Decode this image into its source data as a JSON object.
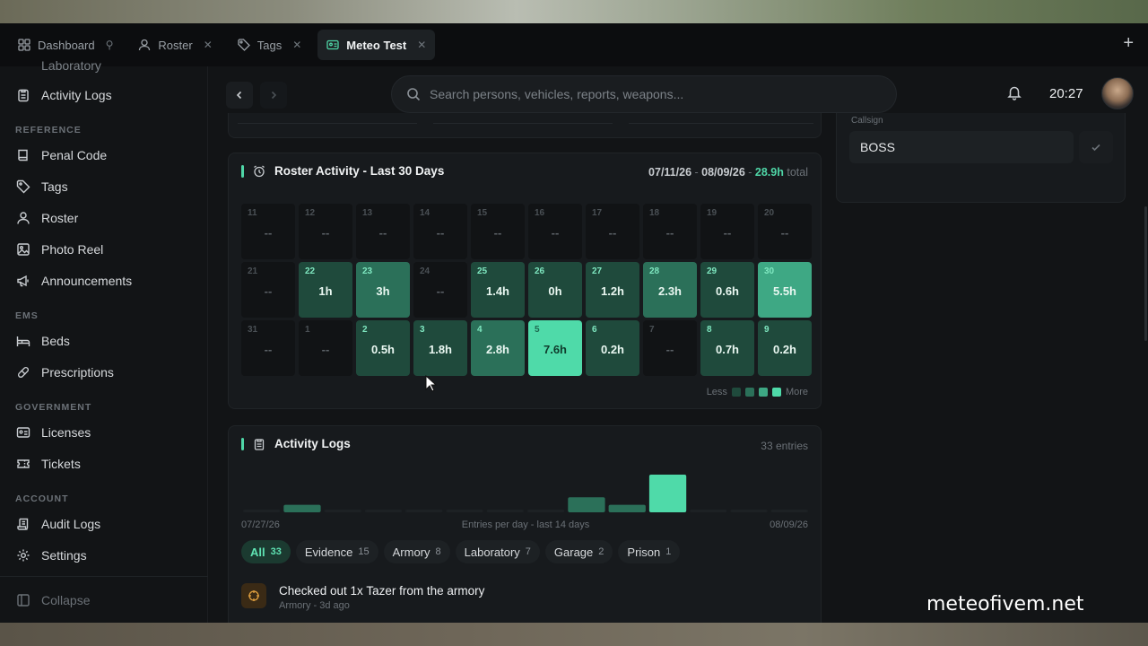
{
  "tabs": [
    {
      "label": "Dashboard",
      "icon": "grid-icon",
      "pinned": true
    },
    {
      "label": "Roster",
      "icon": "user-icon"
    },
    {
      "label": "Tags",
      "icon": "tag-icon"
    },
    {
      "label": "Meteo Test",
      "icon": "id-card-icon",
      "active": true
    }
  ],
  "sidebar": {
    "partial_top": "Laboratory",
    "activity_logs": "Activity Logs",
    "sections": {
      "reference": "REFERENCE",
      "ems": "EMS",
      "government": "GOVERNMENT",
      "account": "ACCOUNT"
    },
    "reference_items": [
      "Penal Code",
      "Tags",
      "Roster",
      "Photo Reel",
      "Announcements"
    ],
    "ems_items": [
      "Beds",
      "Prescriptions"
    ],
    "government_items": [
      "Licenses",
      "Tickets"
    ],
    "account_items": [
      "Audit Logs",
      "Settings"
    ],
    "collapse": "Collapse"
  },
  "topbar": {
    "search_placeholder": "Search persons, vehicles, reports, weapons...",
    "time": "20:27"
  },
  "callsign": {
    "label": "Callsign",
    "value": "BOSS"
  },
  "roster_activity": {
    "title": "Roster Activity - Last 30 Days",
    "range_start": "07/11/26",
    "range_sep": " - ",
    "range_end": "08/09/26",
    "range_dash": " - ",
    "total": "28.9h",
    "total_suffix": "total",
    "legend_less": "Less",
    "legend_more": "More",
    "legend_colors": [
      "#1f4a3c",
      "#2b7059",
      "#3ea884",
      "#4fdaa9"
    ],
    "days": [
      {
        "d": "11",
        "v": "--",
        "level": 0
      },
      {
        "d": "12",
        "v": "--",
        "level": 0
      },
      {
        "d": "13",
        "v": "--",
        "level": 0
      },
      {
        "d": "14",
        "v": "--",
        "level": 0
      },
      {
        "d": "15",
        "v": "--",
        "level": 0
      },
      {
        "d": "16",
        "v": "--",
        "level": 0
      },
      {
        "d": "17",
        "v": "--",
        "level": 0
      },
      {
        "d": "18",
        "v": "--",
        "level": 0
      },
      {
        "d": "19",
        "v": "--",
        "level": 0
      },
      {
        "d": "20",
        "v": "--",
        "level": 0
      },
      {
        "d": "21",
        "v": "--",
        "level": 0
      },
      {
        "d": "22",
        "v": "1h",
        "level": 1
      },
      {
        "d": "23",
        "v": "3h",
        "level": 2
      },
      {
        "d": "24",
        "v": "--",
        "level": 0
      },
      {
        "d": "25",
        "v": "1.4h",
        "level": 1
      },
      {
        "d": "26",
        "v": "0h",
        "level": 1
      },
      {
        "d": "27",
        "v": "1.2h",
        "level": 1
      },
      {
        "d": "28",
        "v": "2.3h",
        "level": 2
      },
      {
        "d": "29",
        "v": "0.6h",
        "level": 1
      },
      {
        "d": "30",
        "v": "5.5h",
        "level": 3
      },
      {
        "d": "31",
        "v": "--",
        "level": 0
      },
      {
        "d": "1",
        "v": "--",
        "level": 0
      },
      {
        "d": "2",
        "v": "0.5h",
        "level": 1
      },
      {
        "d": "3",
        "v": "1.8h",
        "level": 1
      },
      {
        "d": "4",
        "v": "2.8h",
        "level": 2
      },
      {
        "d": "5",
        "v": "7.6h",
        "level": 4
      },
      {
        "d": "6",
        "v": "0.2h",
        "level": 1
      },
      {
        "d": "7",
        "v": "--",
        "level": 0
      },
      {
        "d": "8",
        "v": "0.7h",
        "level": 1
      },
      {
        "d": "9",
        "v": "0.2h",
        "level": 1
      }
    ]
  },
  "activity_logs": {
    "title": "Activity Logs",
    "entries": "33 entries",
    "chart_start": "07/27/26",
    "chart_caption": "Entries per day - last 14 days",
    "chart_end": "08/09/26",
    "filters": [
      {
        "label": "All",
        "count": "33",
        "active": true
      },
      {
        "label": "Evidence",
        "count": "15"
      },
      {
        "label": "Armory",
        "count": "8"
      },
      {
        "label": "Laboratory",
        "count": "7"
      },
      {
        "label": "Garage",
        "count": "2"
      },
      {
        "label": "Prison",
        "count": "1"
      }
    ],
    "first_entry": {
      "text": "Checked out 1x Tazer from the armory",
      "meta": "Armory - 3d ago"
    }
  },
  "chart_data": {
    "type": "bar",
    "title": "",
    "caption": "Entries per day - last 14 days",
    "x_start": "07/27/26",
    "x_end": "08/09/26",
    "values": [
      0,
      1,
      0,
      0,
      0,
      0,
      0,
      0,
      2,
      1,
      5,
      0,
      0,
      0
    ],
    "highlight_index": 10,
    "colors": {
      "normal": "#2b7059",
      "highlight": "#4fdaa9",
      "empty": "#1d2124"
    }
  },
  "watermark": "meteofivem.net"
}
